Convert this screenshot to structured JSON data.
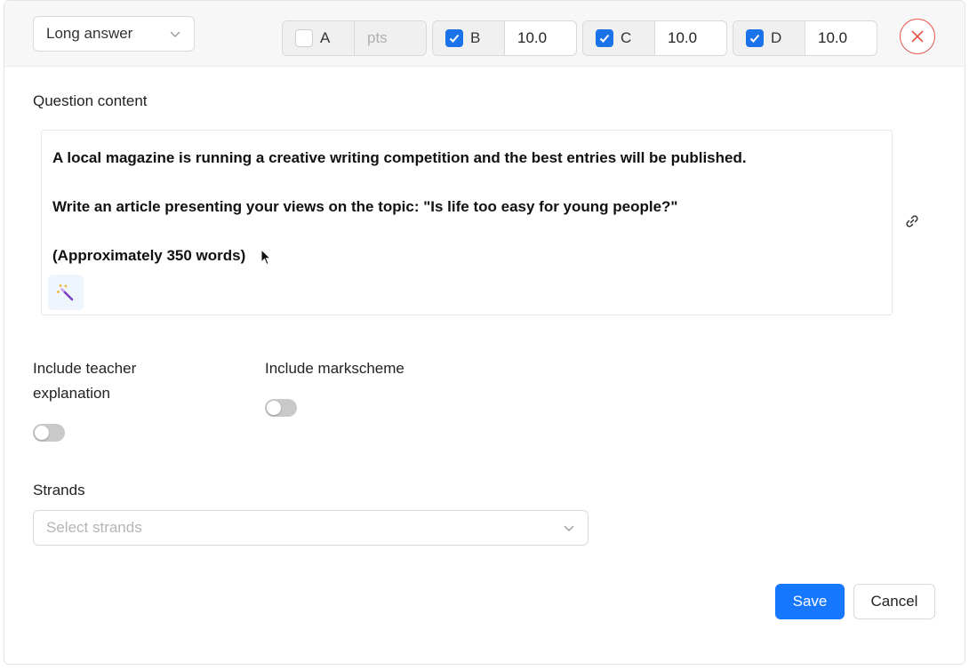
{
  "header": {
    "question_type": "Long answer",
    "options": [
      {
        "letter": "A",
        "checked": false,
        "points": "",
        "points_placeholder": "pts"
      },
      {
        "letter": "B",
        "checked": true,
        "points": "10.0"
      },
      {
        "letter": "C",
        "checked": true,
        "points": "10.0"
      },
      {
        "letter": "D",
        "checked": true,
        "points": "10.0"
      }
    ]
  },
  "question": {
    "label": "Question content",
    "lines": [
      "A local magazine is running a creative writing competition and the best entries will be published.",
      "Write an article presenting your views on the topic: \"Is life too easy for young people?\"",
      "(Approximately 350 words)"
    ]
  },
  "toggles": {
    "teacher_explanation_line1": "Include teacher",
    "teacher_explanation_line2": "explanation",
    "teacher_explanation_on": false,
    "markscheme": "Include markscheme",
    "markscheme_on": false
  },
  "strands": {
    "label": "Strands",
    "placeholder": "Select strands"
  },
  "actions": {
    "save": "Save",
    "cancel": "Cancel"
  },
  "colors": {
    "primary": "#1677ff",
    "checkbox": "#1a73e8",
    "danger": "#e5534b"
  },
  "icons": [
    "chevron-down-icon",
    "check-icon",
    "close-icon",
    "magic-wand-icon",
    "link-icon",
    "mouse-cursor-icon"
  ]
}
